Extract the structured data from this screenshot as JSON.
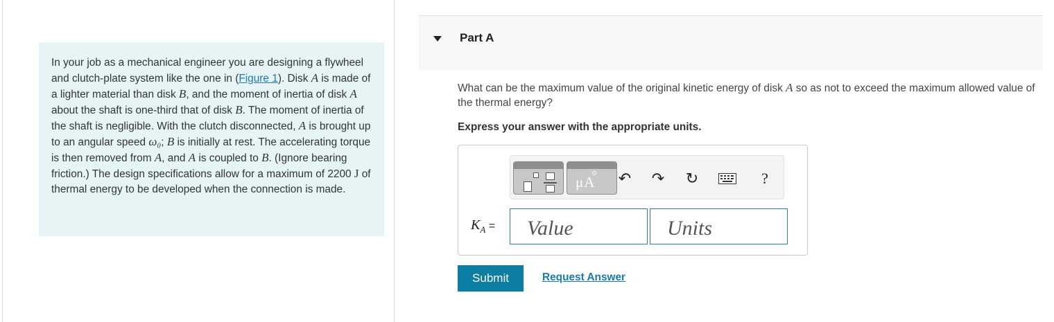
{
  "problem": {
    "t1": "In your job as a mechanical engineer you are designing a flywheel and clutch-plate system like the one in (",
    "figure_link": "Figure 1",
    "t2": "). Disk ",
    "a1": "A",
    "t3": " is made of a lighter material than disk ",
    "b1": "B",
    "t4": ", and the moment of inertia of disk ",
    "a2": "A",
    "t5": " about the shaft is one-third that of disk ",
    "b2": "B",
    "t6": ". The moment of inertia of the shaft is negligible. With the clutch disconnected, ",
    "a3": "A",
    "t7": " is brought up to an angular speed ",
    "omega": "ω₀",
    "t8": "; ",
    "b3": "B",
    "t9": " is initially at rest. The accelerating torque is then removed from ",
    "a4": "A",
    "t10": ", and ",
    "a5": "A",
    "t11": " is coupled to ",
    "b4": "B",
    "t12": ". (Ignore bearing friction.) The design specifications allow for a maximum of 2200 ",
    "unit_j": "J",
    "t13": " of thermal energy to be developed when the connection is made."
  },
  "part": {
    "title": "Part A"
  },
  "question": {
    "q1": "What can be the maximum value of the original kinetic energy of disk ",
    "qa": "A",
    "q2": " so as not to exceed the maximum allowed value of the thermal energy?"
  },
  "instruction": "Express your answer with the appropriate units.",
  "toolbar": {
    "units_symbol": "μA",
    "icons": [
      "templates-icon",
      "units-icon",
      "undo-icon",
      "redo-icon",
      "reset-icon",
      "keyboard-icon",
      "help-icon"
    ],
    "undo": "↶",
    "redo": "↷",
    "reset": "↻",
    "help": "?"
  },
  "answer": {
    "var": "K",
    "sub": "A",
    "eq": " =",
    "value_placeholder": "Value",
    "units_placeholder": "Units"
  },
  "actions": {
    "submit_label": "Submit",
    "request_label": "Request Answer"
  },
  "colors": {
    "accent": "#0d7ea3",
    "link": "#1a7ab0",
    "problem_bg": "#e6f4f5"
  }
}
